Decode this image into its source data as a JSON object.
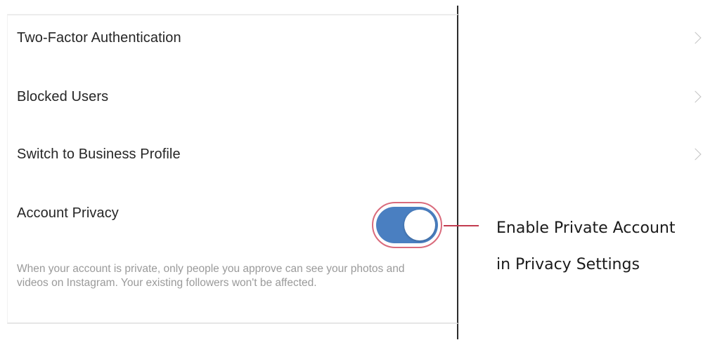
{
  "settings": {
    "items": [
      {
        "label": "Two-Factor Authentication",
        "chevron": "chevron-right-icon"
      },
      {
        "label": "Blocked Users",
        "chevron": "chevron-right-icon"
      },
      {
        "label": "Switch to Business Profile",
        "chevron": "chevron-right-icon"
      }
    ],
    "account_privacy": {
      "label": "Account Privacy",
      "toggle_on": true,
      "description": "When your account is private, only people you approve can see your photos and videos on Instagram. Your existing followers won't be affected."
    }
  },
  "callout": {
    "line1": "Enable Private Account",
    "line2": "in Privacy Settings"
  },
  "colors": {
    "toggle_on": "#4a7fc1",
    "highlight": "#c23b4f",
    "text": "#262626",
    "muted": "#9a9a9a"
  }
}
